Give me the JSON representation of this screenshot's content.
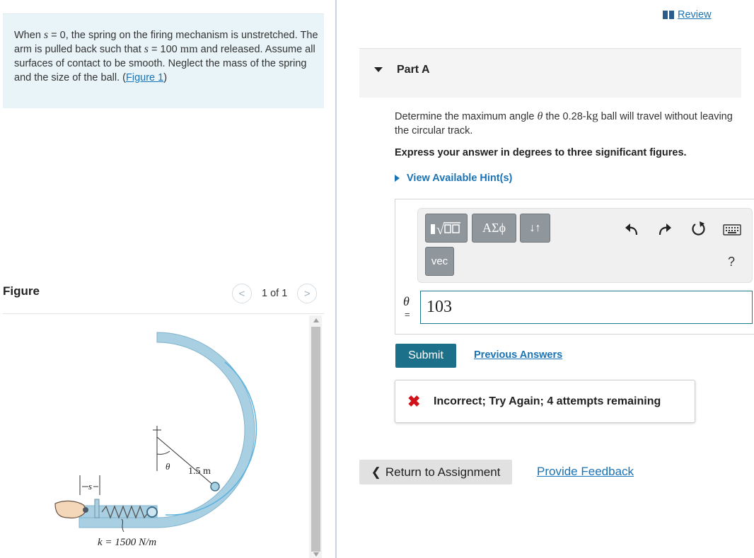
{
  "problem": {
    "t1": "When ",
    "s_var": "s",
    "t2": " = 0, the spring on the firing mechanism is unstretched. The arm is pulled back such that ",
    "s_var2": "s",
    "t3": " = 100 ",
    "unit_mm": "mm",
    "t4": " and released. Assume all surfaces of contact to be smooth. Neglect the mass of the spring and the size of the ball. (",
    "figure_link": "Figure 1",
    "t5": ")"
  },
  "figure": {
    "label": "Figure",
    "counter": "1 of 1",
    "prev_glyph": "<",
    "next_glyph": ">",
    "radius_label": "1.5 m",
    "theta_label": "θ",
    "s_label": "s",
    "k_label": "k = 1500 N/m"
  },
  "review": {
    "label": "Review"
  },
  "part": {
    "title": "Part A"
  },
  "question": {
    "q1": "Determine the maximum angle ",
    "theta": "θ",
    "q2": " the 0.28-",
    "unit_kg": "kg",
    "q3": " ball will travel without leaving the circular track.",
    "express": "Express your answer in degrees to three significant figures.",
    "hint": "View Available Hint(s)"
  },
  "toolbar": {
    "greek": "ΑΣϕ",
    "arrows": "↓↑",
    "vec": "vec",
    "help": "?"
  },
  "answer": {
    "var": "θ",
    "eq": "=",
    "value": "103"
  },
  "actions": {
    "submit": "Submit",
    "previous": "Previous Answers"
  },
  "feedback": {
    "icon": "✖",
    "text": "Incorrect; Try Again; 4 attempts remaining"
  },
  "footer": {
    "return_label": "Return to Assignment",
    "return_glyph": "❮",
    "provide": "Provide Feedback"
  },
  "colors": {
    "problem_bg": "#e8f4f7",
    "link": "#1a73b5",
    "submit": "#1d7089",
    "error": "#d0121b",
    "track": "#a9cfe2"
  }
}
